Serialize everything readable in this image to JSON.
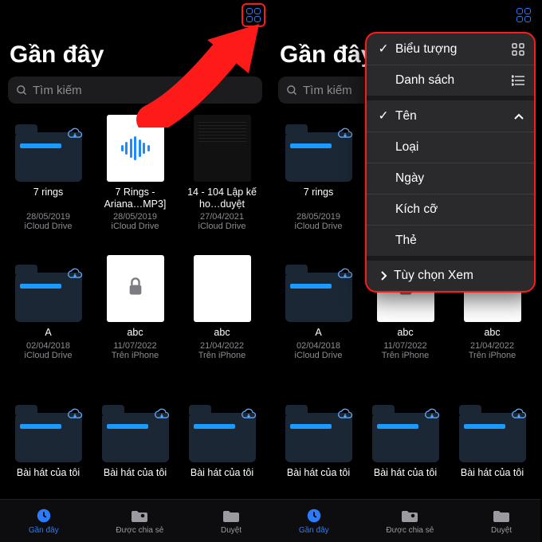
{
  "title": "Gần đây",
  "search_placeholder": "Tìm kiếm",
  "files_row1": [
    {
      "name": "7 rings",
      "date": "28/05/2019",
      "loc": "iCloud Drive",
      "type": "folder"
    },
    {
      "name": "7 Rings - Ariana…MP3]",
      "date": "28/05/2019",
      "loc": "iCloud Drive",
      "type": "audio"
    },
    {
      "name": "14 - 104  Lập kế ho…duyệt",
      "date": "27/04/2021",
      "loc": "iCloud Drive",
      "type": "darkdoc"
    }
  ],
  "files_row2": [
    {
      "name": "A",
      "date": "02/04/2018",
      "loc": "iCloud Drive",
      "type": "folder"
    },
    {
      "name": "abc",
      "date": "11/07/2022",
      "loc": "Trên iPhone",
      "type": "locked"
    },
    {
      "name": "abc",
      "date": "21/04/2022",
      "loc": "Trên iPhone",
      "type": "blank"
    }
  ],
  "files_row3": [
    {
      "name": "Bài hát của tôi",
      "type": "folder"
    },
    {
      "name": "Bài hát của tôi",
      "type": "folder"
    },
    {
      "name": "Bài hát của tôi",
      "type": "folder"
    }
  ],
  "tabs": [
    {
      "label": "Gần đây",
      "active": true
    },
    {
      "label": "Được chia sẻ",
      "active": false
    },
    {
      "label": "Duyệt",
      "active": false
    }
  ],
  "menu": {
    "view_icons": "Biểu tượng",
    "view_list": "Danh sách",
    "sort_name": "Tên",
    "sort_kind": "Loại",
    "sort_date": "Ngày",
    "sort_size": "Kích cỡ",
    "sort_tags": "Thẻ",
    "view_options": "Tùy chọn Xem"
  }
}
